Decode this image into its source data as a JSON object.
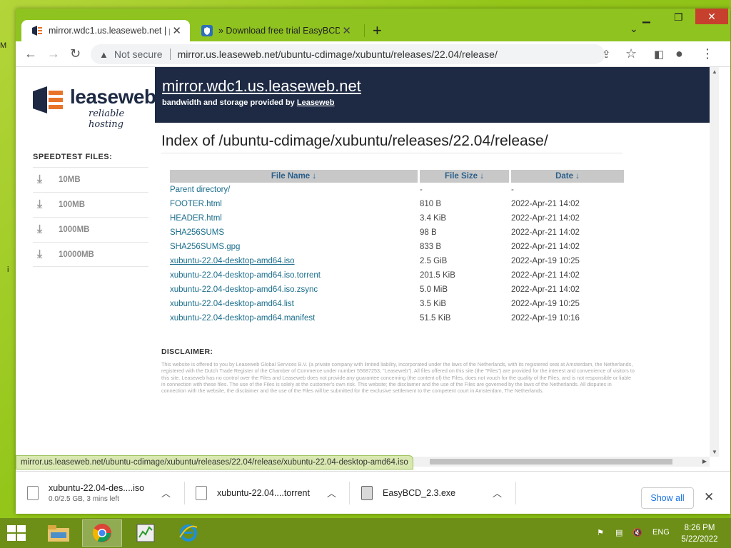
{
  "desktop": {
    "left_fragment_1": "M",
    "left_fragment_2": "i"
  },
  "browser": {
    "tabs": [
      {
        "label": "mirror.wdc1.us.leaseweb.net | po",
        "active": true
      },
      {
        "label": "» Download free trial EasyBCD",
        "active": false
      }
    ],
    "new_tab": "+",
    "omnibox": {
      "security": "Not secure",
      "url": "mirror.us.leaseweb.net/ubuntu-cdimage/xubuntu/releases/22.04/release/"
    },
    "status_url": "mirror.us.leaseweb.net/ubuntu-cdimage/xubuntu/releases/22.04/release/xubuntu-22.04-desktop-amd64.iso"
  },
  "page": {
    "logo": {
      "word": "leaseweb",
      "tagline": "reliable hosting"
    },
    "banner": {
      "host": "mirror.wdc1.us.leaseweb.net",
      "sub_prefix": "bandwidth and storage provided by ",
      "sub_link": "Leaseweb"
    },
    "sidebar": {
      "title": "SPEEDTEST FILES:",
      "items": [
        {
          "label": "10MB"
        },
        {
          "label": "100MB"
        },
        {
          "label": "1000MB"
        },
        {
          "label": "10000MB"
        }
      ]
    },
    "index_title": "Index of /ubuntu-cdimage/xubuntu/releases/22.04/release/",
    "table": {
      "headers": [
        "File Name ↓",
        "File Size ↓",
        "Date ↓"
      ],
      "rows": [
        [
          "Parent directory/",
          "-",
          "-"
        ],
        [
          "FOOTER.html",
          "810 B",
          "2022-Apr-21 14:02"
        ],
        [
          "HEADER.html",
          "3.4 KiB",
          "2022-Apr-21 14:02"
        ],
        [
          "SHA256SUMS",
          "98 B",
          "2022-Apr-21 14:02"
        ],
        [
          "SHA256SUMS.gpg",
          "833 B",
          "2022-Apr-21 14:02"
        ],
        [
          "xubuntu-22.04-desktop-amd64.iso",
          "2.5 GiB",
          "2022-Apr-19 10:25"
        ],
        [
          "xubuntu-22.04-desktop-amd64.iso.torrent",
          "201.5 KiB",
          "2022-Apr-21 14:02"
        ],
        [
          "xubuntu-22.04-desktop-amd64.iso.zsync",
          "5.0 MiB",
          "2022-Apr-21 14:02"
        ],
        [
          "xubuntu-22.04-desktop-amd64.list",
          "3.5 KiB",
          "2022-Apr-19 10:25"
        ],
        [
          "xubuntu-22.04-desktop-amd64.manifest",
          "51.5 KiB",
          "2022-Apr-19 10:16"
        ]
      ]
    },
    "disclaimer_title": "DISCLAIMER:",
    "disclaimer_text": "This website is offered to you by Leaseweb Global Services B.V. (a private company with limited liability, incorporated under the laws of the Netherlands, with its registered seat at Amsterdam, the Netherlands, registered with the Dutch Trade Register of the Chamber of Commerce under number 55687253, \"Leaseweb\"). All files offered on this site (the \"Files\") are provided for the interest and convenience of visitors to this site. Leaseweb has no control over the Files and Leaseweb does not provide any guarantee concerning (the content of) the Files, does not vouch for the quality of the Files, and is not responsible or liable in connection with these files. The use of the Files is solely at the customer's own risk. This website; the disclaimer and the use of the Files are governed by the laws of the Netherlands. All disputes in connection with the website, the disclaimer and the use of the Files will be submitted for the exclusive settlement to the competent court in Amsterdam, The Netherlands."
  },
  "downloads": {
    "items": [
      {
        "name": "xubuntu-22.04-des....iso",
        "sub": "0.0/2.5 GB, 3 mins left"
      },
      {
        "name": "xubuntu-22.04....torrent",
        "sub": ""
      },
      {
        "name": "EasyBCD_2.3.exe",
        "sub": ""
      }
    ],
    "show_all": "Show all"
  },
  "taskbar": {
    "lang": "ENG",
    "time": "8:26 PM",
    "date": "5/22/2022"
  },
  "colors": {
    "desktop": "#8fc31f",
    "banner": "#1e2a44",
    "link": "#1b6e8c",
    "header_cell": "#c8c8c8"
  }
}
